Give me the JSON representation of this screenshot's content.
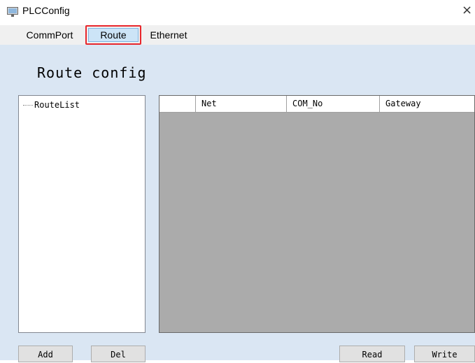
{
  "window": {
    "title": "PLCConfig",
    "close_glyph": "×"
  },
  "tabs": [
    {
      "label": "CommPort"
    },
    {
      "label": "Route"
    },
    {
      "label": "Ethernet"
    }
  ],
  "panel": {
    "heading": "Route config",
    "tree": {
      "root": "RouteList"
    },
    "table": {
      "columns": [
        "",
        "Net",
        "COM_No",
        "Gateway"
      ]
    },
    "buttons": {
      "add": "Add",
      "del": "Del",
      "read": "Read",
      "write": "Write"
    }
  },
  "colors": {
    "panel_bg": "#dae6f3",
    "grid_bg": "#ababab",
    "selected_tab_border": "#e8262b",
    "selected_tab_fill": "#cce4f7"
  }
}
